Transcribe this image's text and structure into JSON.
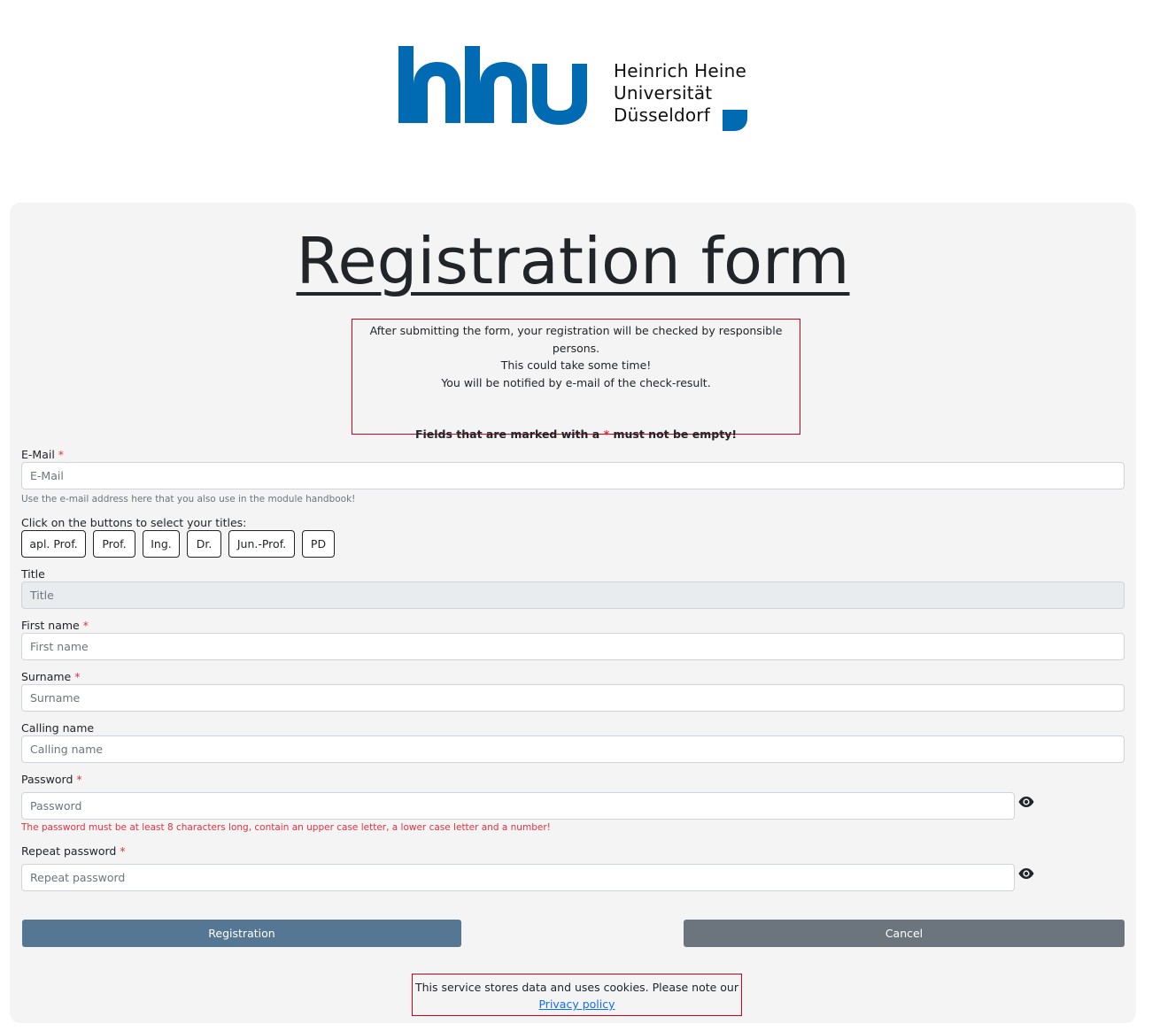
{
  "logo": {
    "mark": "hhu",
    "line1": "Heinrich Heine",
    "line2": "Universität",
    "line3": "Düsseldorf",
    "brand_color": "#006ab3"
  },
  "page_title": "Registration form",
  "notice": {
    "line1": "After submitting the form, your registration will be checked by responsible persons.",
    "line2": "This could take some time!",
    "line3": "You will be notified by e-mail of the check-result.",
    "required_prefix": "Fields that are marked with a",
    "required_marker": "*",
    "required_suffix": "must not be empty!"
  },
  "form": {
    "required_marker": "*",
    "email": {
      "label": "E-Mail",
      "placeholder": "E-Mail",
      "value": "",
      "help": "Use the e-mail address here that you also use in the module handbook!"
    },
    "titles_prompt": "Click on the buttons to select your titles:",
    "title_buttons": [
      "apl. Prof.",
      "Prof.",
      "Ing.",
      "Dr.",
      "Jun.-Prof.",
      "PD"
    ],
    "title": {
      "label": "Title",
      "placeholder": "Title",
      "value": ""
    },
    "first_name": {
      "label": "First name",
      "placeholder": "First name",
      "value": ""
    },
    "surname": {
      "label": "Surname",
      "placeholder": "Surname",
      "value": ""
    },
    "calling_name": {
      "label": "Calling name",
      "placeholder": "Calling name",
      "value": ""
    },
    "password": {
      "label": "Password",
      "placeholder": "Password",
      "value": "",
      "error": "The password must be at least 8 characters long, contain an upper case letter, a lower case letter and a number!"
    },
    "repeat_password": {
      "label": "Repeat password",
      "placeholder": "Repeat password",
      "value": ""
    },
    "submit_label": "Registration",
    "cancel_label": "Cancel"
  },
  "cookie_notice": {
    "text": "This service stores data and uses cookies. Please note our",
    "link_text": "Privacy policy"
  },
  "icons": {
    "show_password": "eye-icon"
  },
  "colors": {
    "primary_button": "#557794",
    "secondary_button": "#6c757d",
    "required": "#dc3545",
    "notice_border": "#d0021b",
    "card_background": "#f4f4f4"
  }
}
